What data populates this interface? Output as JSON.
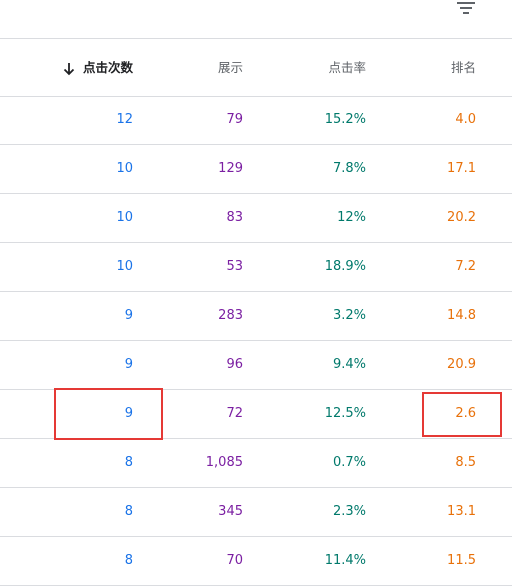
{
  "headers": {
    "clicks": "点击次数",
    "impressions": "展示",
    "ctr": "点击率",
    "position": "排名"
  },
  "colors": {
    "clicks": "#1a73e8",
    "impressions": "#7b1fa2",
    "ctr": "#00796b",
    "position": "#e8710a",
    "highlight": "#e53935"
  },
  "rows": [
    {
      "clicks": "12",
      "impressions": "79",
      "ctr": "15.2%",
      "position": "4.0"
    },
    {
      "clicks": "10",
      "impressions": "129",
      "ctr": "7.8%",
      "position": "17.1"
    },
    {
      "clicks": "10",
      "impressions": "83",
      "ctr": "12%",
      "position": "20.2"
    },
    {
      "clicks": "10",
      "impressions": "53",
      "ctr": "18.9%",
      "position": "7.2"
    },
    {
      "clicks": "9",
      "impressions": "283",
      "ctr": "3.2%",
      "position": "14.8"
    },
    {
      "clicks": "9",
      "impressions": "96",
      "ctr": "9.4%",
      "position": "20.9"
    },
    {
      "clicks": "9",
      "impressions": "72",
      "ctr": "12.5%",
      "position": "2.6"
    },
    {
      "clicks": "8",
      "impressions": "1,085",
      "ctr": "0.7%",
      "position": "8.5"
    },
    {
      "clicks": "8",
      "impressions": "345",
      "ctr": "2.3%",
      "position": "13.1"
    },
    {
      "clicks": "8",
      "impressions": "70",
      "ctr": "11.4%",
      "position": "11.5"
    }
  ],
  "icons": {
    "filter": "filter-icon",
    "sort": "arrow-down-icon"
  }
}
